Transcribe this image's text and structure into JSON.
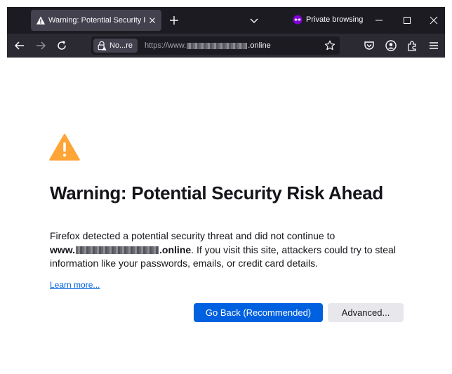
{
  "window": {
    "tab": {
      "title": "Warning: Potential Security Risk Ahead"
    },
    "private_label": "Private browsing"
  },
  "navbar": {
    "identity_label": "No...re",
    "url": {
      "prefix": "https://www.",
      "suffix": ".online"
    }
  },
  "page": {
    "heading": "Warning: Potential Security Risk Ahead",
    "desc_line1": "Firefox detected a potential security threat and did not continue to",
    "domain_prefix": "www.",
    "domain_suffix": ".online",
    "desc_rest": ". If you visit this site, attackers could try to steal information like your passwords, emails, or credit card details.",
    "learn_more": "Learn more...",
    "go_back": "Go Back (Recommended)",
    "advanced": "Advanced..."
  },
  "colors": {
    "chrome_dark": "#1c1b22",
    "toolbar": "#2b2a33",
    "accent_blue": "#0061e0",
    "warning_orange": "#ffa436",
    "private_purple": "#8000d7"
  },
  "icons": [
    "warning-icon",
    "close-icon",
    "plus-icon",
    "chevron-down-icon",
    "private-mask-icon",
    "minimize-icon",
    "maximize-icon",
    "close-window-icon",
    "back-arrow-icon",
    "forward-arrow-icon",
    "reload-icon",
    "lock-warning-icon",
    "star-icon",
    "pocket-icon",
    "account-icon",
    "extensions-icon",
    "menu-icon"
  ]
}
